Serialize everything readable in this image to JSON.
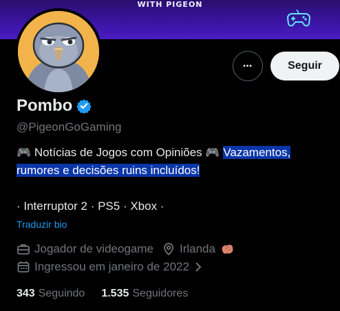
{
  "banner": {
    "text": "WITH PIGEON"
  },
  "actions": {
    "more_label": "•••",
    "follow_label": "Seguir"
  },
  "profile": {
    "name": "Pombo",
    "handle": "@PigeonGoGaming",
    "bio_line1_plain": "🎮 Notícias de Jogos com Opiniões 🎮 ",
    "bio_line1_highlight": "Vazamentos, rumores e decisões ruins incluídos!",
    "bio_line2": "· Interruptor 2 · PS5 · Xbox ·",
    "translate_label": "Traduzir bio"
  },
  "meta": {
    "category": "Jogador de videogame",
    "location": "Irlanda",
    "location_flag_icon": "potato-icon",
    "joined": "Ingressou em janeiro de 2022"
  },
  "stats": {
    "following_count": "343",
    "following_label": "Seguindo",
    "followers_count": "1.535",
    "followers_label": "Seguidores"
  },
  "colors": {
    "background": "#000000",
    "text": "#e7e9ea",
    "secondary_text": "#71767b",
    "link": "#1d9bf0",
    "highlight": "#0a36a8",
    "verified": "#1d9bf0",
    "avatar_bg": "#f2b44a",
    "banner": "#3a14a0"
  }
}
